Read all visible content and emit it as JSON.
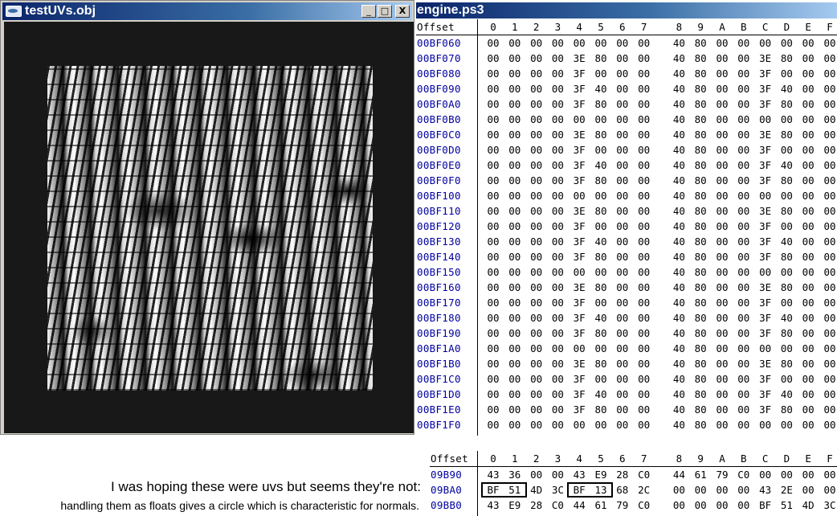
{
  "uv_window": {
    "title": "testUVs.obj",
    "icon": "app-window-icon",
    "controls": {
      "minimize": "_",
      "maximize": "□",
      "close": "X"
    }
  },
  "hex_window": {
    "title": "engine.ps3",
    "header": {
      "offset_label": "Offset",
      "columns": [
        "0",
        "1",
        "2",
        "3",
        "4",
        "5",
        "6",
        "7",
        "8",
        "9",
        "A",
        "B",
        "C",
        "D",
        "E",
        "F"
      ]
    },
    "rows": [
      {
        "offset": "00BF060",
        "bytes": [
          "00",
          "00",
          "00",
          "00",
          "00",
          "00",
          "00",
          "00",
          "40",
          "80",
          "00",
          "00",
          "00",
          "00",
          "00",
          "00"
        ]
      },
      {
        "offset": "00BF070",
        "bytes": [
          "00",
          "00",
          "00",
          "00",
          "3E",
          "80",
          "00",
          "00",
          "40",
          "80",
          "00",
          "00",
          "3E",
          "80",
          "00",
          "00"
        ]
      },
      {
        "offset": "00BF080",
        "bytes": [
          "00",
          "00",
          "00",
          "00",
          "3F",
          "00",
          "00",
          "00",
          "40",
          "80",
          "00",
          "00",
          "3F",
          "00",
          "00",
          "00"
        ]
      },
      {
        "offset": "00BF090",
        "bytes": [
          "00",
          "00",
          "00",
          "00",
          "3F",
          "40",
          "00",
          "00",
          "40",
          "80",
          "00",
          "00",
          "3F",
          "40",
          "00",
          "00"
        ]
      },
      {
        "offset": "00BF0A0",
        "bytes": [
          "00",
          "00",
          "00",
          "00",
          "3F",
          "80",
          "00",
          "00",
          "40",
          "80",
          "00",
          "00",
          "3F",
          "80",
          "00",
          "00"
        ]
      },
      {
        "offset": "00BF0B0",
        "bytes": [
          "00",
          "00",
          "00",
          "00",
          "00",
          "00",
          "00",
          "00",
          "40",
          "80",
          "00",
          "00",
          "00",
          "00",
          "00",
          "00"
        ]
      },
      {
        "offset": "00BF0C0",
        "bytes": [
          "00",
          "00",
          "00",
          "00",
          "3E",
          "80",
          "00",
          "00",
          "40",
          "80",
          "00",
          "00",
          "3E",
          "80",
          "00",
          "00"
        ]
      },
      {
        "offset": "00BF0D0",
        "bytes": [
          "00",
          "00",
          "00",
          "00",
          "3F",
          "00",
          "00",
          "00",
          "40",
          "80",
          "00",
          "00",
          "3F",
          "00",
          "00",
          "00"
        ]
      },
      {
        "offset": "00BF0E0",
        "bytes": [
          "00",
          "00",
          "00",
          "00",
          "3F",
          "40",
          "00",
          "00",
          "40",
          "80",
          "00",
          "00",
          "3F",
          "40",
          "00",
          "00"
        ]
      },
      {
        "offset": "00BF0F0",
        "bytes": [
          "00",
          "00",
          "00",
          "00",
          "3F",
          "80",
          "00",
          "00",
          "40",
          "80",
          "00",
          "00",
          "3F",
          "80",
          "00",
          "00"
        ]
      },
      {
        "offset": "00BF100",
        "bytes": [
          "00",
          "00",
          "00",
          "00",
          "00",
          "00",
          "00",
          "00",
          "40",
          "80",
          "00",
          "00",
          "00",
          "00",
          "00",
          "00"
        ]
      },
      {
        "offset": "00BF110",
        "bytes": [
          "00",
          "00",
          "00",
          "00",
          "3E",
          "80",
          "00",
          "00",
          "40",
          "80",
          "00",
          "00",
          "3E",
          "80",
          "00",
          "00"
        ]
      },
      {
        "offset": "00BF120",
        "bytes": [
          "00",
          "00",
          "00",
          "00",
          "3F",
          "00",
          "00",
          "00",
          "40",
          "80",
          "00",
          "00",
          "3F",
          "00",
          "00",
          "00"
        ]
      },
      {
        "offset": "00BF130",
        "bytes": [
          "00",
          "00",
          "00",
          "00",
          "3F",
          "40",
          "00",
          "00",
          "40",
          "80",
          "00",
          "00",
          "3F",
          "40",
          "00",
          "00"
        ]
      },
      {
        "offset": "00BF140",
        "bytes": [
          "00",
          "00",
          "00",
          "00",
          "3F",
          "80",
          "00",
          "00",
          "40",
          "80",
          "00",
          "00",
          "3F",
          "80",
          "00",
          "00"
        ]
      },
      {
        "offset": "00BF150",
        "bytes": [
          "00",
          "00",
          "00",
          "00",
          "00",
          "00",
          "00",
          "00",
          "40",
          "80",
          "00",
          "00",
          "00",
          "00",
          "00",
          "00"
        ]
      },
      {
        "offset": "00BF160",
        "bytes": [
          "00",
          "00",
          "00",
          "00",
          "3E",
          "80",
          "00",
          "00",
          "40",
          "80",
          "00",
          "00",
          "3E",
          "80",
          "00",
          "00"
        ]
      },
      {
        "offset": "00BF170",
        "bytes": [
          "00",
          "00",
          "00",
          "00",
          "3F",
          "00",
          "00",
          "00",
          "40",
          "80",
          "00",
          "00",
          "3F",
          "00",
          "00",
          "00"
        ]
      },
      {
        "offset": "00BF180",
        "bytes": [
          "00",
          "00",
          "00",
          "00",
          "3F",
          "40",
          "00",
          "00",
          "40",
          "80",
          "00",
          "00",
          "3F",
          "40",
          "00",
          "00"
        ]
      },
      {
        "offset": "00BF190",
        "bytes": [
          "00",
          "00",
          "00",
          "00",
          "3F",
          "80",
          "00",
          "00",
          "40",
          "80",
          "00",
          "00",
          "3F",
          "80",
          "00",
          "00"
        ]
      },
      {
        "offset": "00BF1A0",
        "bytes": [
          "00",
          "00",
          "00",
          "00",
          "00",
          "00",
          "00",
          "00",
          "40",
          "80",
          "00",
          "00",
          "00",
          "00",
          "00",
          "00"
        ]
      },
      {
        "offset": "00BF1B0",
        "bytes": [
          "00",
          "00",
          "00",
          "00",
          "3E",
          "80",
          "00",
          "00",
          "40",
          "80",
          "00",
          "00",
          "3E",
          "80",
          "00",
          "00"
        ]
      },
      {
        "offset": "00BF1C0",
        "bytes": [
          "00",
          "00",
          "00",
          "00",
          "3F",
          "00",
          "00",
          "00",
          "40",
          "80",
          "00",
          "00",
          "3F",
          "00",
          "00",
          "00"
        ]
      },
      {
        "offset": "00BF1D0",
        "bytes": [
          "00",
          "00",
          "00",
          "00",
          "3F",
          "40",
          "00",
          "00",
          "40",
          "80",
          "00",
          "00",
          "3F",
          "40",
          "00",
          "00"
        ]
      },
      {
        "offset": "00BF1E0",
        "bytes": [
          "00",
          "00",
          "00",
          "00",
          "3F",
          "80",
          "00",
          "00",
          "40",
          "80",
          "00",
          "00",
          "3F",
          "80",
          "00",
          "00"
        ]
      },
      {
        "offset": "00BF1F0",
        "bytes": [
          "00",
          "00",
          "00",
          "00",
          "00",
          "00",
          "00",
          "00",
          "40",
          "80",
          "00",
          "00",
          "00",
          "00",
          "00",
          "00"
        ]
      }
    ]
  },
  "hex_snippet": {
    "header": {
      "offset_label": "Offset",
      "columns": [
        "0",
        "1",
        "2",
        "3",
        "4",
        "5",
        "6",
        "7",
        "8",
        "9",
        "A",
        "B",
        "C",
        "D",
        "E",
        "F"
      ]
    },
    "rows": [
      {
        "offset": "09B90",
        "bytes": [
          "43",
          "36",
          "00",
          "00",
          "43",
          "E9",
          "28",
          "C0",
          "44",
          "61",
          "79",
          "C0",
          "00",
          "00",
          "00",
          "00"
        ],
        "boxed": []
      },
      {
        "offset": "09BA0",
        "bytes": [
          "BF",
          "51",
          "4D",
          "3C",
          "BF",
          "13",
          "68",
          "2C",
          "00",
          "00",
          "00",
          "00",
          "43",
          "2E",
          "00",
          "00"
        ],
        "boxed": [
          [
            0,
            1
          ],
          [
            4,
            5
          ]
        ]
      },
      {
        "offset": "09BB0",
        "bytes": [
          "43",
          "E9",
          "28",
          "C0",
          "44",
          "61",
          "79",
          "C0",
          "00",
          "00",
          "00",
          "00",
          "BF",
          "51",
          "4D",
          "3C"
        ],
        "boxed": []
      }
    ]
  },
  "caption": {
    "line1": "I was hoping these were uvs but seems they're not:",
    "line2": "handling them as floats gives a circle which is characteristic for normals."
  }
}
